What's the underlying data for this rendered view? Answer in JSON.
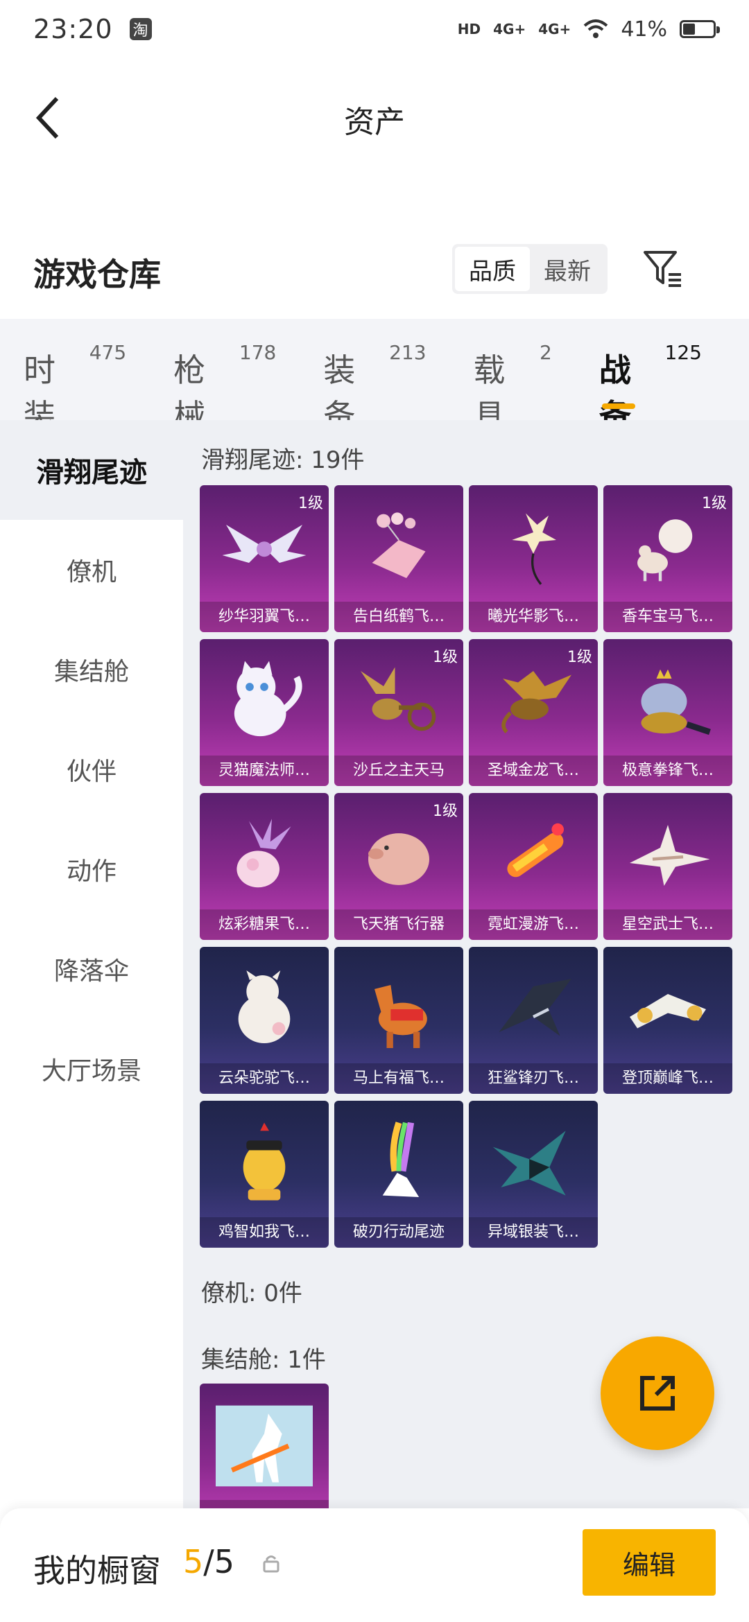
{
  "status_bar": {
    "time": "23:20",
    "battery": "41%",
    "battery_level": 0.41,
    "hd": "HD",
    "net1": "4G+",
    "net2": "4G+"
  },
  "header": {
    "title": "资产"
  },
  "warehouse": {
    "title": "游戏仓库",
    "sort_quality": "品质",
    "sort_newest": "最新"
  },
  "tabs": [
    {
      "label": "时装",
      "count": "475"
    },
    {
      "label": "枪械",
      "count": "178"
    },
    {
      "label": "装备",
      "count": "213"
    },
    {
      "label": "载具",
      "count": "2"
    },
    {
      "label": "战备",
      "count": "125"
    }
  ],
  "sidebar": [
    "滑翔尾迹",
    "僚机",
    "集结舱",
    "伙伴",
    "动作",
    "降落伞",
    "大厅场景"
  ],
  "sections": {
    "glide": {
      "title": "滑翔尾迹: 19件"
    },
    "wingman": {
      "title": "僚机: 0件"
    },
    "pod": {
      "title": "集结舱: 1件"
    }
  },
  "items": [
    {
      "name": "纱华羽翼飞…",
      "level": "1级",
      "rarity": "pink",
      "art": "wings"
    },
    {
      "name": "告白纸鹤飞…",
      "level": "",
      "rarity": "pink",
      "art": "crane"
    },
    {
      "name": "曦光华影飞…",
      "level": "",
      "rarity": "pink",
      "art": "flower"
    },
    {
      "name": "香车宝马飞…",
      "level": "1级",
      "rarity": "pink",
      "art": "carriage"
    },
    {
      "name": "灵猫魔法师…",
      "level": "",
      "rarity": "pink",
      "art": "cat"
    },
    {
      "name": "沙丘之主天马",
      "level": "1级",
      "rarity": "pink",
      "art": "pegasus"
    },
    {
      "name": "圣域金龙飞…",
      "level": "1级",
      "rarity": "pink",
      "art": "dragon"
    },
    {
      "name": "极意拳锋飞…",
      "level": "",
      "rarity": "pink",
      "art": "elephant"
    },
    {
      "name": "炫彩糖果飞…",
      "level": "",
      "rarity": "pink",
      "art": "candy"
    },
    {
      "name": "飞天猪飞行器",
      "level": "1级",
      "rarity": "pink",
      "art": "pig"
    },
    {
      "name": "霓虹漫游飞…",
      "level": "",
      "rarity": "pink",
      "art": "rocket"
    },
    {
      "name": "星空武士飞…",
      "level": "",
      "rarity": "pink",
      "art": "blade"
    },
    {
      "name": "云朵驼驼飞…",
      "level": "",
      "rarity": "blue",
      "art": "alpaca"
    },
    {
      "name": "马上有福飞…",
      "level": "",
      "rarity": "blue",
      "art": "horse"
    },
    {
      "name": "狂鲨锋刃飞…",
      "level": "",
      "rarity": "blue",
      "art": "shark"
    },
    {
      "name": "登顶巅峰飞…",
      "level": "",
      "rarity": "blue",
      "art": "jet"
    },
    {
      "name": "鸡智如我飞…",
      "level": "",
      "rarity": "blue",
      "art": "chicken"
    },
    {
      "name": "破刃行动尾迹",
      "level": "",
      "rarity": "blue",
      "art": "trail"
    },
    {
      "name": "异域银装飞…",
      "level": "",
      "rarity": "blue",
      "art": "glider"
    }
  ],
  "pod_items": [
    {
      "name": "",
      "level": "",
      "rarity": "pink",
      "art": "pod"
    }
  ],
  "showcase": {
    "label": "我的橱窗",
    "used": "5",
    "total": "/5"
  },
  "edit_button": "编辑",
  "colors": {
    "accent": "#f5a800",
    "pink_card": "#8a2a8e",
    "blue_card": "#2c2f63"
  }
}
